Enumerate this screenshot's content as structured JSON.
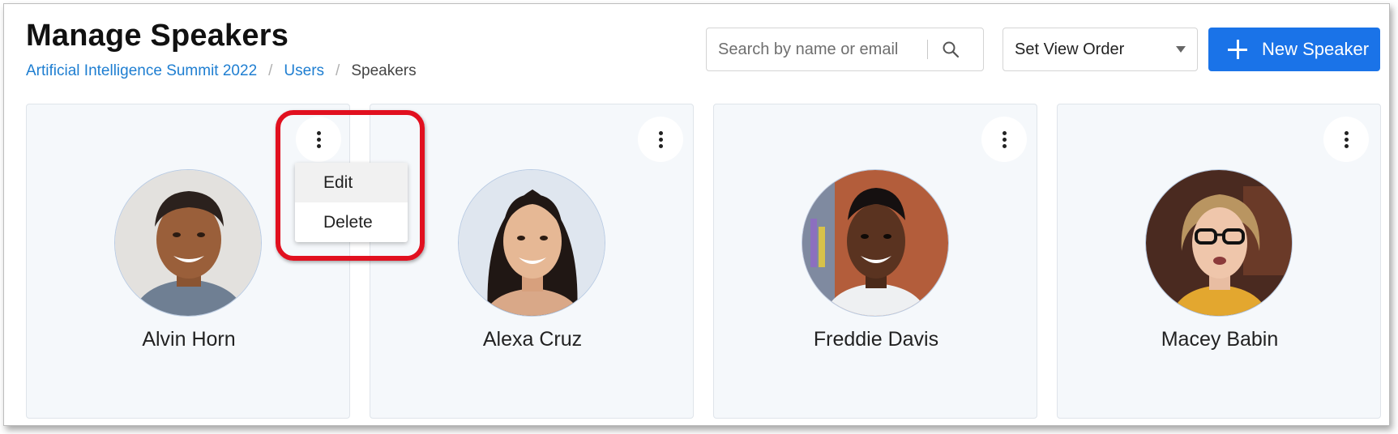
{
  "header": {
    "title": "Manage Speakers",
    "breadcrumb": [
      {
        "label": "Artificial Intelligence Summit 2022",
        "link": true
      },
      {
        "label": "Users",
        "link": true
      },
      {
        "label": "Speakers",
        "link": false
      }
    ]
  },
  "toolbar": {
    "search_placeholder": "Search by name or email",
    "search_icon": "search-icon",
    "view_order_label": "Set View Order",
    "new_button_label": "New Speaker",
    "new_button_icon": "plus-icon",
    "accent_color": "#1a73e8"
  },
  "speakers": [
    {
      "name": "Alvin Horn"
    },
    {
      "name": "Alexa Cruz"
    },
    {
      "name": "Freddie Davis"
    },
    {
      "name": "Macey Babin"
    }
  ],
  "card_menu": {
    "open_on": "Alvin Horn",
    "items": [
      {
        "label": "Edit"
      },
      {
        "label": "Delete"
      }
    ],
    "highlight_color": "#e1101f"
  }
}
